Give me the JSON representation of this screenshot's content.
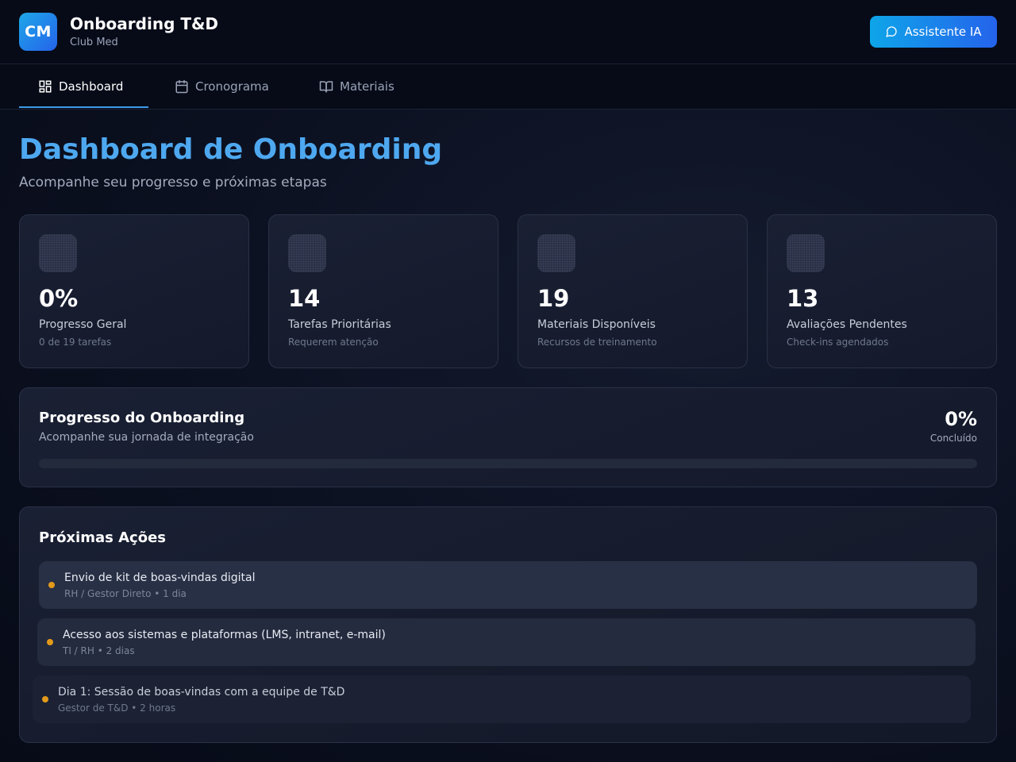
{
  "header": {
    "logo_text": "CM",
    "title": "Onboarding T&D",
    "subtitle": "Club Med",
    "assistant_label": "Assistente IA"
  },
  "nav": {
    "tabs": [
      {
        "label": "Dashboard",
        "icon": "dashboard-icon",
        "active": true
      },
      {
        "label": "Cronograma",
        "icon": "calendar-icon",
        "active": false
      },
      {
        "label": "Materiais",
        "icon": "book-icon",
        "active": false
      }
    ]
  },
  "page": {
    "title": "Dashboard de Onboarding",
    "subtitle": "Acompanhe seu progresso e próximas etapas"
  },
  "stats": [
    {
      "value": "0%",
      "label": "Progresso Geral",
      "sub": "0 de 19 tarefas"
    },
    {
      "value": "14",
      "label": "Tarefas Prioritárias",
      "sub": "Requerem atenção"
    },
    {
      "value": "19",
      "label": "Materiais Disponíveis",
      "sub": "Recursos de treinamento"
    },
    {
      "value": "13",
      "label": "Avaliações Pendentes",
      "sub": "Check-ins agendados"
    }
  ],
  "progress": {
    "title": "Progresso do Onboarding",
    "subtitle": "Acompanhe sua jornada de integração",
    "value": "0%",
    "value_label": "Concluído",
    "fraction": 0
  },
  "actions": {
    "title": "Próximas Ações",
    "items": [
      {
        "title": "Envio de kit de boas-vindas digital",
        "meta": "RH / Gestor Direto • 1 dia"
      },
      {
        "title": "Acesso aos sistemas e plataformas (LMS, intranet, e-mail)",
        "meta": "TI / RH • 2 dias"
      },
      {
        "title": "Dia 1: Sessão de boas-vindas com a equipe de T&D",
        "meta": "Gestor de T&D • 2 horas"
      }
    ]
  },
  "colors": {
    "accent": "#4ea8f0",
    "button_gradient_start": "#0ea5e9",
    "button_gradient_end": "#2563eb",
    "status_dot": "#e39a1a"
  }
}
